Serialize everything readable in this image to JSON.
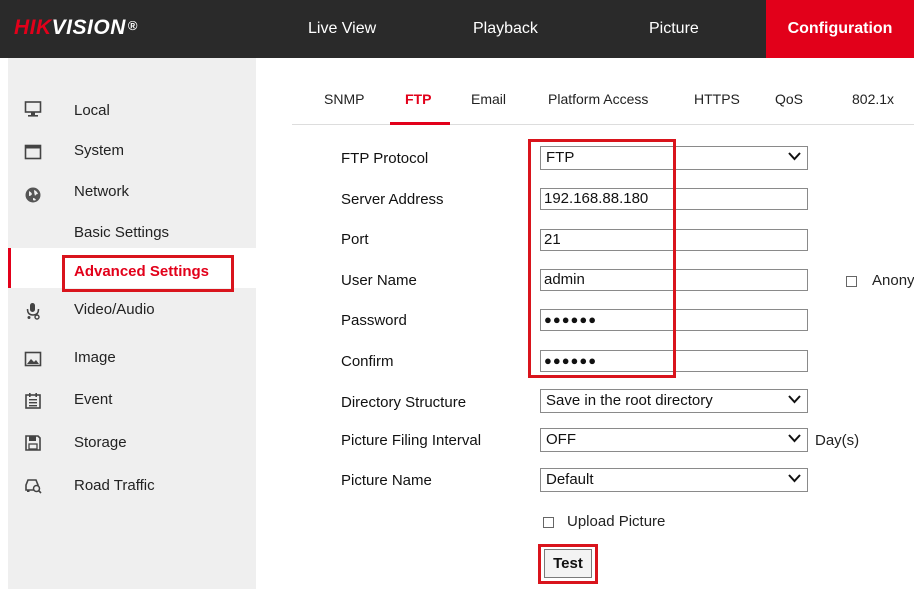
{
  "brand": {
    "hik": "HIK",
    "vision": "VISION",
    "reg": "®"
  },
  "topnav": {
    "items": [
      "Live View",
      "Playback",
      "Picture",
      "Configuration"
    ],
    "active": "Configuration"
  },
  "sidebar": {
    "items": [
      {
        "label": "Local",
        "icon": "monitor-icon"
      },
      {
        "label": "System",
        "icon": "window-icon"
      },
      {
        "label": "Network",
        "icon": "globe-icon"
      },
      {
        "label": "Video/Audio",
        "icon": "microphone-icon"
      },
      {
        "label": "Image",
        "icon": "image-icon"
      },
      {
        "label": "Event",
        "icon": "calendar-icon"
      },
      {
        "label": "Storage",
        "icon": "floppy-icon"
      },
      {
        "label": "Road Traffic",
        "icon": "car-camera-icon"
      }
    ],
    "network_sub": {
      "basic": "Basic Settings",
      "advanced": "Advanced Settings"
    }
  },
  "tabs": [
    "SNMP",
    "FTP",
    "Email",
    "Platform Access",
    "HTTPS",
    "QoS",
    "802.1x"
  ],
  "active_tab": "FTP",
  "form": {
    "ftp_protocol": {
      "label": "FTP Protocol",
      "value": "FTP"
    },
    "server_address": {
      "label": "Server Address",
      "value": "192.168.88.180"
    },
    "port": {
      "label": "Port",
      "value": "21"
    },
    "user_name": {
      "label": "User Name",
      "value": "admin"
    },
    "anonymous": {
      "label": "Anony"
    },
    "password": {
      "label": "Password",
      "value": "●●●●●●"
    },
    "confirm": {
      "label": "Confirm",
      "value": "●●●●●●"
    },
    "directory_structure": {
      "label": "Directory Structure",
      "value": "Save in the root directory"
    },
    "picture_filing_interval": {
      "label": "Picture Filing Interval",
      "value": "OFF",
      "unit": "Day(s)"
    },
    "picture_name": {
      "label": "Picture Name",
      "value": "Default"
    },
    "upload_picture": {
      "label": "Upload Picture",
      "checked": false
    },
    "test_button": "Test"
  },
  "colors": {
    "accent": "#e2001a",
    "topbar": "#2a2a2a",
    "sidebar": "#efefef",
    "highlight": "#d9141c"
  }
}
